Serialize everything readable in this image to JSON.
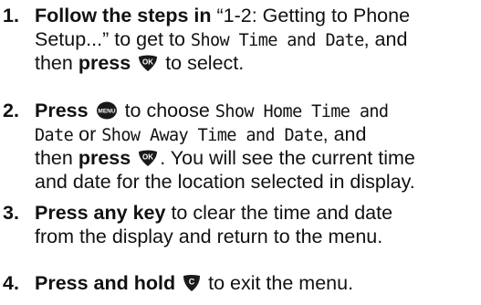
{
  "steps": [
    {
      "num": "1.",
      "line1": {
        "bold": "Follow the steps in",
        "quote": "“1-2: Getting to Phone"
      },
      "line2": {
        "quote_end": "Setup...” to get to",
        "menu": "Show Time and Date",
        "tail": ", and"
      },
      "line3": {
        "pre": "then",
        "bold": "press",
        "key_label": "OK",
        "post": "to select."
      }
    },
    {
      "num": "2.",
      "line1": {
        "bold": "Press",
        "key_label": "MENU",
        "text": "to choose",
        "menu": "Show Home Time and"
      },
      "line2": {
        "menu_end": "Date",
        "or": "or",
        "menu": "Show Away Time and Date",
        "tail": ", and"
      },
      "line3": {
        "pre": "then",
        "bold": "press",
        "key_label": "OK",
        "post": ". You will see the current time"
      },
      "line4": "and date for the location selected in display."
    },
    {
      "num": "3.",
      "line1": {
        "bold": "Press any key",
        "text": "to clear the time and date"
      },
      "line2": "from the display and return to the menu."
    },
    {
      "num": "4.",
      "line1": {
        "bold": "Press and hold",
        "key_label": "C",
        "post": "to exit the menu."
      }
    }
  ]
}
